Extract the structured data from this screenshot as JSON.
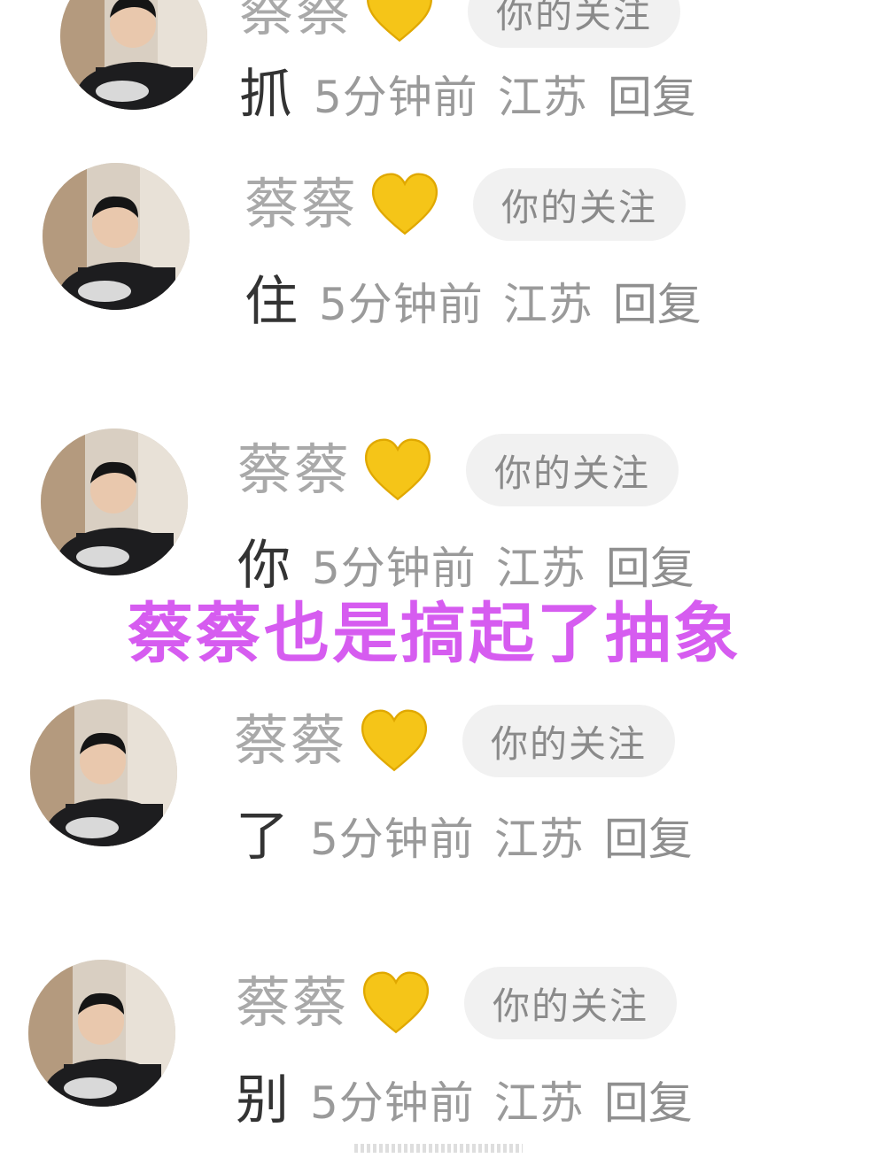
{
  "comments": [
    {
      "username": "蔡蔡",
      "badge": "你的关注",
      "text": "抓",
      "time": "5分钟前",
      "location": "江苏",
      "reply": "回复"
    },
    {
      "username": "蔡蔡",
      "badge": "你的关注",
      "text": "住",
      "time": "5分钟前",
      "location": "江苏",
      "reply": "回复"
    },
    {
      "username": "蔡蔡",
      "badge": "你的关注",
      "text": "你",
      "time": "5分钟前",
      "location": "江苏",
      "reply": "回复"
    },
    {
      "username": "蔡蔡",
      "badge": "你的关注",
      "text": "了",
      "time": "5分钟前",
      "location": "江苏",
      "reply": "回复"
    },
    {
      "username": "蔡蔡",
      "badge": "你的关注",
      "text": "别",
      "time": "5分钟前",
      "location": "江苏",
      "reply": "回复"
    }
  ],
  "caption": "蔡蔡也是搞起了抽象",
  "colors": {
    "caption": "#d65cf0",
    "username": "#a9a9a9",
    "heart": "#f5c518",
    "badge_bg": "#f1f1f1"
  },
  "icons": [
    "avatar-photo",
    "yellow-heart-icon"
  ]
}
